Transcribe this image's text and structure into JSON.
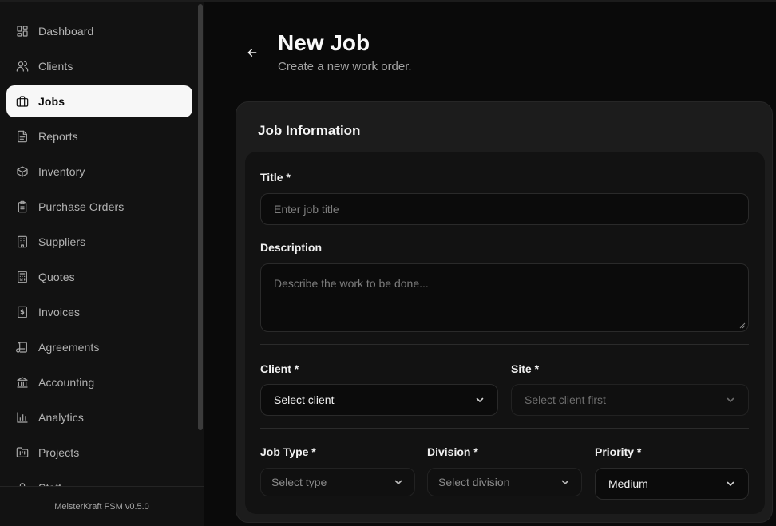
{
  "sidebar": {
    "items": [
      {
        "label": "Dashboard",
        "icon": "dashboard-icon",
        "active": false
      },
      {
        "label": "Clients",
        "icon": "users-icon",
        "active": false
      },
      {
        "label": "Jobs",
        "icon": "briefcase-icon",
        "active": true
      },
      {
        "label": "Reports",
        "icon": "file-text-icon",
        "active": false
      },
      {
        "label": "Inventory",
        "icon": "package-icon",
        "active": false
      },
      {
        "label": "Purchase Orders",
        "icon": "clipboard-icon",
        "active": false
      },
      {
        "label": "Suppliers",
        "icon": "building-icon",
        "active": false
      },
      {
        "label": "Quotes",
        "icon": "calculator-icon",
        "active": false
      },
      {
        "label": "Invoices",
        "icon": "dollar-file-icon",
        "active": false
      },
      {
        "label": "Agreements",
        "icon": "scroll-icon",
        "active": false
      },
      {
        "label": "Accounting",
        "icon": "bank-icon",
        "active": false
      },
      {
        "label": "Analytics",
        "icon": "bar-chart-icon",
        "active": false
      },
      {
        "label": "Projects",
        "icon": "folder-kanban-icon",
        "active": false
      },
      {
        "label": "Staff",
        "icon": "user-icon",
        "active": false
      }
    ],
    "footer": "MeisterKraft FSM v0.5.0"
  },
  "header": {
    "title": "New Job",
    "subtitle": "Create a new work order."
  },
  "form": {
    "section_title": "Job Information",
    "title_label": "Title *",
    "title_placeholder": "Enter job title",
    "description_label": "Description",
    "description_placeholder": "Describe the work to be done...",
    "client_label": "Client *",
    "client_value": "Select client",
    "site_label": "Site *",
    "site_value": "Select client first",
    "job_type_label": "Job Type *",
    "job_type_value": "Select type",
    "division_label": "Division *",
    "division_value": "Select division",
    "priority_label": "Priority *",
    "priority_value": "Medium"
  },
  "colors": {
    "background": "#0a0a0a",
    "sidebar": "#121212",
    "active_nav": "#f7f7f7",
    "card": "#1c1c1c"
  }
}
